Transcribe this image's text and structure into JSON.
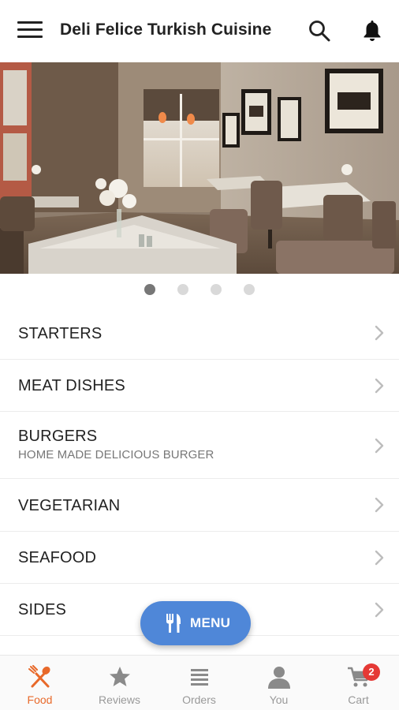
{
  "app": {
    "title": "Deli Felice Turkish Cuisine"
  },
  "header": {
    "menu_icon": "hamburger-icon",
    "search_icon": "search-icon",
    "notification_icon": "bell-icon"
  },
  "carousel": {
    "slide_count": 4,
    "active_index": 0
  },
  "categories": [
    {
      "label": "STARTERS",
      "subtitle": ""
    },
    {
      "label": "MEAT DISHES",
      "subtitle": ""
    },
    {
      "label": "BURGERS",
      "subtitle": "HOME MADE DELICIOUS BURGER"
    },
    {
      "label": "VEGETARIAN",
      "subtitle": ""
    },
    {
      "label": "SEAFOOD",
      "subtitle": ""
    },
    {
      "label": "SIDES",
      "subtitle": ""
    }
  ],
  "fab": {
    "label": "MENU",
    "icon": "fork-knife-icon",
    "color": "#4f87d8"
  },
  "bottom_nav": {
    "items": [
      {
        "label": "Food",
        "icon": "fork-spoon-icon",
        "active": true
      },
      {
        "label": "Reviews",
        "icon": "star-icon",
        "active": false
      },
      {
        "label": "Orders",
        "icon": "list-icon",
        "active": false
      },
      {
        "label": "You",
        "icon": "person-icon",
        "active": false
      },
      {
        "label": "Cart",
        "icon": "cart-icon",
        "active": false,
        "badge": "2"
      }
    ],
    "active_color": "#e8692a",
    "badge_color": "#e53935"
  }
}
